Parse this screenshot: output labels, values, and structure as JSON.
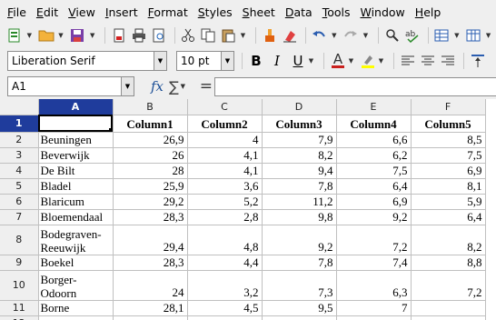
{
  "menubar": {
    "items": [
      "File",
      "Edit",
      "View",
      "Insert",
      "Format",
      "Styles",
      "Sheet",
      "Data",
      "Tools",
      "Window",
      "Help"
    ]
  },
  "toolbar": {
    "icons": [
      "new-document-icon",
      "open-folder-icon",
      "save-icon",
      "export-pdf-icon",
      "print-icon",
      "print-preview-icon",
      "cut-icon",
      "copy-icon",
      "paste-icon",
      "clone-formatting-icon",
      "clear-formatting-icon",
      "undo-icon",
      "redo-icon",
      "find-replace-icon",
      "spelling-icon",
      "row-icon",
      "column-icon"
    ]
  },
  "format": {
    "font_name": "Liberation Serif",
    "font_size": "10 pt",
    "bold": "B",
    "italic": "I",
    "underline": "U",
    "font_color": "A",
    "font_color_hex": "#c9211e",
    "highlight_hex": "#ffff00"
  },
  "formula": {
    "cell_ref": "A1",
    "fx": "fx",
    "sum": "∑",
    "equals": "=",
    "content": ""
  },
  "sheet": {
    "columns": [
      "A",
      "B",
      "C",
      "D",
      "E",
      "F"
    ],
    "selected_column": "A",
    "selected_row": "1",
    "header_row": [
      "",
      "Column1",
      "Column2",
      "Column3",
      "Column4",
      "Column5"
    ],
    "rows": [
      {
        "num": "2",
        "name": "Beuningen",
        "c1": "26,9",
        "c2": "4",
        "c3": "7,9",
        "c4": "6,6",
        "c5": "8,5"
      },
      {
        "num": "3",
        "name": "Beverwijk",
        "c1": "26",
        "c2": "4,1",
        "c3": "8,2",
        "c4": "6,2",
        "c5": "7,5"
      },
      {
        "num": "4",
        "name": "De Bilt",
        "c1": "28",
        "c2": "4,1",
        "c3": "9,4",
        "c4": "7,5",
        "c5": "6,9"
      },
      {
        "num": "5",
        "name": "Bladel",
        "c1": "25,9",
        "c2": "3,6",
        "c3": "7,8",
        "c4": "6,4",
        "c5": "8,1"
      },
      {
        "num": "6",
        "name": "Blaricum",
        "c1": "29,2",
        "c2": "5,2",
        "c3": "11,2",
        "c4": "6,9",
        "c5": "5,9"
      },
      {
        "num": "7",
        "name": "Bloemendaal",
        "c1": "28,3",
        "c2": "2,8",
        "c3": "9,8",
        "c4": "9,2",
        "c5": "6,4"
      },
      {
        "num": "8",
        "name_line1": "Bodegraven-",
        "name_line2": "Reeuwijk",
        "c1": "29,4",
        "c2": "4,8",
        "c3": "9,2",
        "c4": "7,2",
        "c5": "8,2"
      },
      {
        "num": "9",
        "name": "Boekel",
        "c1": "28,3",
        "c2": "4,4",
        "c3": "7,8",
        "c4": "7,4",
        "c5": "8,8"
      },
      {
        "num": "10",
        "name_line1": "Borger-",
        "name_line2": "Odoorn",
        "c1": "24",
        "c2": "3,2",
        "c3": "7,3",
        "c4": "6,3",
        "c5": "7,2"
      },
      {
        "num": "11",
        "name": "Borne",
        "c1": "28,1",
        "c2": "4,5",
        "c3": "9,5",
        "c4": "7",
        "c5": ""
      },
      {
        "num": "12",
        "name": "",
        "c1": "",
        "c2": "",
        "c3": "",
        "c4": "",
        "c5": ""
      }
    ]
  }
}
